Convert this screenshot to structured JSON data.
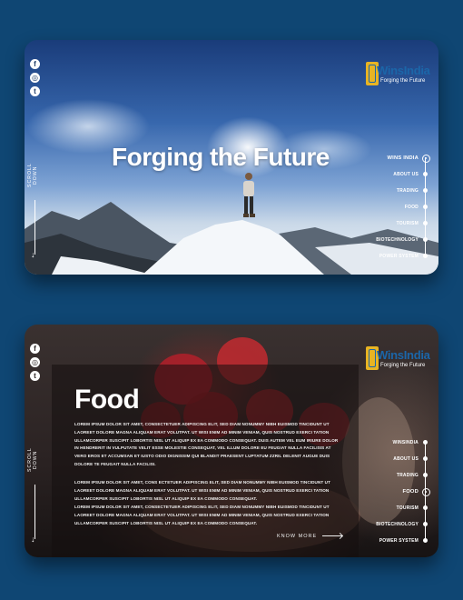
{
  "brand": {
    "name": "WinsIndia",
    "tagline": "Forging the Future"
  },
  "social": {
    "facebook": "f",
    "instagram": "◎",
    "twitter": "t"
  },
  "scroll_label": "SCROLL DOWN",
  "hero": {
    "title": "Forging the Future"
  },
  "nav_hero": {
    "items": [
      "WINS INDIA",
      "ABOUT US",
      "TRADING",
      "FOOD",
      "TOURISM",
      "BIOTECHNOLOGY",
      "POWER SYSTEM"
    ],
    "active": "WINS INDIA"
  },
  "food": {
    "title": "Food",
    "para1": "Lorem ipsum dolor sit amet, consectetuer adipiscing elit, sed diam nonummy nibh euismod tincidunt ut laoreet dolore magna aliquam erat volutpat. Ut wisi enim ad minim veniam, quis nostrud exerci tation ullamcorper suscipit lobortis nisl ut aliquip ex ea commodo consequat. Duis autem vel eum iriure dolor in hendrerit in vulputate velit esse molestie consequat, vel illum dolore eu feugiat nulla facilisis at vero eros et accumsan et iusto odio dignissim qui blandit praesent luptatum zzril delenit augue duis dolore te feugait nulla facilisi.",
    "para2": "Lorem ipsum dolor sit amet, cons ectetuer adipiscing elit, sed diam nonummy nibh euismod tincidunt ut laoreet dolore magna aliquam erat volutpat. Ut wisi enim ad minim veniam, quis nostrud exerci tation ullamcorper suscipit lobortis nisl ut aliquip ex ea commodo consequat.",
    "para3": "Lorem ipsum dolor sit amet, consectetuer adipiscing elit, sed diam nonummy nibh euismod tincidunt ut laoreet dolore magna aliquam erat volutpat. Ut wisi enim ad minim veniam, quis nostrud exerci tation ullamcorper suscipit lobortis nisl ut aliquip ex ea commodo consequat.",
    "cta": "KNOW MORE"
  },
  "nav_food": {
    "items": [
      "WINSINDIA",
      "ABOUT US",
      "TRADING",
      "FOOD",
      "TOURISM",
      "BIOTECHNOLOGY",
      "POWER SYSTEM"
    ],
    "active": "FOOD"
  },
  "colors": {
    "background": "#0f4673",
    "logo_blue": "#1b66a9",
    "logo_gold": "#e8b423"
  }
}
